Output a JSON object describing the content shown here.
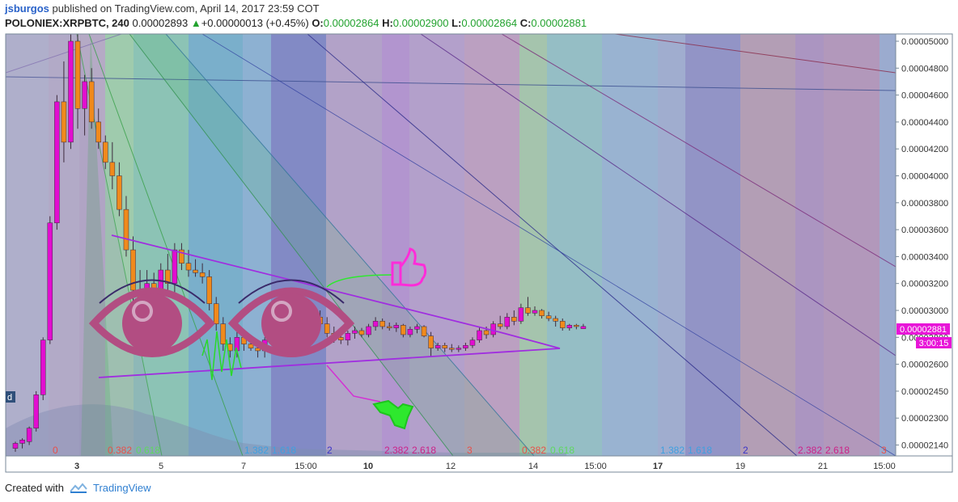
{
  "header": {
    "username": "jsburgos",
    "published_text": "published on TradingView.com, April 14, 2017 23:59 COT",
    "symbol": "POLONIEX:XRPBTC, 240",
    "last_price": "0.00002893",
    "change_arrow": "▲",
    "change": "+0.00000013 (+0.45%)",
    "open_label": "O:",
    "open_value": "0.00002864",
    "high_label": "H:",
    "high_value": "0.00002900",
    "low_label": "L:",
    "low_value": "0.00002864",
    "close_label": "C:",
    "close_value": "0.00002881"
  },
  "price_tag": {
    "price": "0.00002881",
    "countdown": "3:00:15",
    "color": "#e815d8"
  },
  "left_stub": "d",
  "footer": {
    "created_with": "Created with",
    "brand": "TradingView"
  },
  "colors": {
    "bull": "#e20dd0",
    "bear": "#f08a1c",
    "axis_text": "#333333",
    "pattern_line": "#a02de0",
    "eyes": "#b24d82",
    "thumb": "#ff2cd9",
    "arrow": "#2ee82e"
  },
  "chart_data": {
    "type": "candlestick",
    "y_ticks": [
      "0.00005000",
      "0.00004800",
      "0.00004600",
      "0.00004400",
      "0.00004200",
      "0.00004000",
      "0.00003800",
      "0.00003600",
      "0.00003400",
      "0.00003200",
      "0.00003000",
      "0.00002800",
      "0.00002600",
      "0.00002450",
      "0.00002300",
      "0.00002140"
    ],
    "x_ticks": [
      {
        "label": "3",
        "bold": true
      },
      {
        "label": "5",
        "bold": false
      },
      {
        "label": "7",
        "bold": false
      },
      {
        "label": "15:00",
        "bold": false
      },
      {
        "label": "10",
        "bold": true
      },
      {
        "label": "12",
        "bold": false
      },
      {
        "label": "14",
        "bold": false
      },
      {
        "label": "15:00",
        "bold": false
      },
      {
        "label": "17",
        "bold": true
      },
      {
        "label": "19",
        "bold": false
      },
      {
        "label": "21",
        "bold": false
      },
      {
        "label": "15:00",
        "bold": false
      }
    ],
    "fib_labels": [
      {
        "text": "0",
        "color": "#e8504a"
      },
      {
        "text": "0.382",
        "color": "#e8504a"
      },
      {
        "text": "0.618",
        "color": "#5fd85f"
      },
      {
        "text": "1.382",
        "color": "#3fa0e0"
      },
      {
        "text": "1.618",
        "color": "#3fa0e0"
      },
      {
        "text": "2",
        "color": "#3a34c8"
      },
      {
        "text": "2.382",
        "color": "#cc2288"
      },
      {
        "text": "2.618",
        "color": "#cc2288"
      },
      {
        "text": "3",
        "color": "#e8504a"
      },
      {
        "text": "0.382",
        "color": "#e8504a"
      },
      {
        "text": "0.618",
        "color": "#5fd85f"
      },
      {
        "text": "1.382",
        "color": "#3fa0e0"
      },
      {
        "text": "1.618",
        "color": "#3fa0e0"
      },
      {
        "text": "2",
        "color": "#3a34c8"
      },
      {
        "text": "2.382",
        "color": "#cc2288"
      },
      {
        "text": "2.618",
        "color": "#cc2288"
      },
      {
        "text": "3",
        "color": "#e8504a"
      }
    ],
    "candles": [
      [
        2.12e-05,
        2.16e-05,
        2.1e-05,
        2.15e-05
      ],
      [
        2.15e-05,
        2.18e-05,
        2.12e-05,
        2.17e-05
      ],
      [
        2.16e-05,
        2.25e-05,
        2.14e-05,
        2.24e-05
      ],
      [
        2.24e-05,
        2.45e-05,
        2.22e-05,
        2.43e-05
      ],
      [
        2.43e-05,
        2.8e-05,
        2.4e-05,
        2.78e-05
      ],
      [
        2.78e-05,
        3.7e-05,
        2.75e-05,
        3.65e-05
      ],
      [
        3.65e-05,
        4.6e-05,
        3.6e-05,
        4.55e-05
      ],
      [
        4.55e-05,
        4.85e-05,
        4.1e-05,
        4.25e-05
      ],
      [
        4.25e-05,
        5.05e-05,
        4.2e-05,
        5e-05
      ],
      [
        5e-05,
        5.15e-05,
        4.35e-05,
        4.5e-05
      ],
      [
        4.5e-05,
        4.75e-05,
        4.3e-05,
        4.7e-05
      ],
      [
        4.7e-05,
        4.8e-05,
        4.35e-05,
        4.4e-05
      ],
      [
        4.4e-05,
        4.5e-05,
        4.2e-05,
        4.25e-05
      ],
      [
        4.25e-05,
        4.3e-05,
        4.05e-05,
        4.1e-05
      ],
      [
        4.1e-05,
        4.25e-05,
        3.9e-05,
        4e-05
      ],
      [
        4e-05,
        4.1e-05,
        3.7e-05,
        3.75e-05
      ],
      [
        3.75e-05,
        3.85e-05,
        3.4e-05,
        3.45e-05
      ],
      [
        3.45e-05,
        3.55e-05,
        3.05e-05,
        3.15e-05
      ],
      [
        3.15e-05,
        3.3e-05,
        2.9e-05,
        3.05e-05
      ],
      [
        3.05e-05,
        3.3e-05,
        2.95e-05,
        3.2e-05
      ],
      [
        3.2e-05,
        3.28e-05,
        3.1e-05,
        3.15e-05
      ],
      [
        3.15e-05,
        3.35e-05,
        3e-05,
        3.3e-05
      ],
      [
        3.3e-05,
        3.42e-05,
        3.15e-05,
        3.2e-05
      ],
      [
        3.2e-05,
        3.5e-05,
        3.1e-05,
        3.45e-05
      ],
      [
        3.45e-05,
        3.5e-05,
        3.3e-05,
        3.35e-05
      ],
      [
        3.35e-05,
        3.45e-05,
        3.25e-05,
        3.3e-05
      ],
      [
        3.3e-05,
        3.38e-05,
        3.25e-05,
        3.28e-05
      ],
      [
        3.28e-05,
        3.35e-05,
        3.2e-05,
        3.25e-05
      ],
      [
        3.25e-05,
        3.3e-05,
        3e-05,
        3.05e-05
      ],
      [
        3.05e-05,
        3.1e-05,
        2.85e-05,
        2.9e-05
      ],
      [
        2.9e-05,
        2.95e-05,
        2.7e-05,
        2.75e-05
      ],
      [
        2.75e-05,
        2.8e-05,
        2.65e-05,
        2.7e-05
      ],
      [
        2.7e-05,
        2.85e-05,
        2.65e-05,
        2.8e-05
      ],
      [
        2.8e-05,
        2.85e-05,
        2.7e-05,
        2.75e-05
      ],
      [
        2.75e-05,
        2.8e-05,
        2.7e-05,
        2.72e-05
      ],
      [
        2.72e-05,
        2.78e-05,
        2.65e-05,
        2.7e-05
      ],
      [
        2.7e-05,
        2.8e-05,
        2.65e-05,
        2.78e-05
      ],
      [
        2.78e-05,
        2.95e-05,
        2.75e-05,
        2.9e-05
      ],
      [
        2.9e-05,
        3.05e-05,
        2.88e-05,
        3e-05
      ],
      [
        3e-05,
        3.1e-05,
        2.95e-05,
        3.05e-05
      ],
      [
        3.05e-05,
        3.08e-05,
        2.98e-05,
        3.02e-05
      ],
      [
        3.02e-05,
        3.06e-05,
        2.98e-05,
        3.04e-05
      ],
      [
        3.04e-05,
        3.08e-05,
        2.95e-05,
        3e-05
      ],
      [
        3e-05,
        3.05e-05,
        2.92e-05,
        2.95e-05
      ],
      [
        2.95e-05,
        3e-05,
        2.88e-05,
        2.9e-05
      ],
      [
        2.9e-05,
        2.95e-05,
        2.8e-05,
        2.83e-05
      ],
      [
        2.83e-05,
        2.88e-05,
        2.76e-05,
        2.8e-05
      ],
      [
        2.8e-05,
        2.85e-05,
        2.75e-05,
        2.78e-05
      ],
      [
        2.78e-05,
        2.85e-05,
        2.74e-05,
        2.83e-05
      ],
      [
        2.83e-05,
        2.88e-05,
        2.79e-05,
        2.85e-05
      ],
      [
        2.85e-05,
        2.87e-05,
        2.8e-05,
        2.82e-05
      ],
      [
        2.82e-05,
        2.9e-05,
        2.8e-05,
        2.88e-05
      ],
      [
        2.88e-05,
        2.95e-05,
        2.85e-05,
        2.92e-05
      ],
      [
        2.92e-05,
        2.94e-05,
        2.86e-05,
        2.88e-05
      ],
      [
        2.88e-05,
        2.91e-05,
        2.85e-05,
        2.87e-05
      ],
      [
        2.87e-05,
        2.91e-05,
        2.84e-05,
        2.89e-05
      ],
      [
        2.89e-05,
        2.9e-05,
        2.8e-05,
        2.82e-05
      ],
      [
        2.82e-05,
        2.88e-05,
        2.8e-05,
        2.86e-05
      ],
      [
        2.86e-05,
        2.9e-05,
        2.83e-05,
        2.88e-05
      ],
      [
        2.88e-05,
        2.89e-05,
        2.8e-05,
        2.81e-05
      ],
      [
        2.81e-05,
        2.84e-05,
        2.66e-05,
        2.72e-05
      ],
      [
        2.72e-05,
        2.76e-05,
        2.7e-05,
        2.74e-05
      ],
      [
        2.74e-05,
        2.76e-05,
        2.69e-05,
        2.72e-05
      ],
      [
        2.72e-05,
        2.75e-05,
        2.69e-05,
        2.71e-05
      ],
      [
        2.71e-05,
        2.74e-05,
        2.69e-05,
        2.72e-05
      ],
      [
        2.72e-05,
        2.76e-05,
        2.7e-05,
        2.74e-05
      ],
      [
        2.74e-05,
        2.8e-05,
        2.72e-05,
        2.78e-05
      ],
      [
        2.78e-05,
        2.88e-05,
        2.76e-05,
        2.85e-05
      ],
      [
        2.85e-05,
        2.88e-05,
        2.79e-05,
        2.82e-05
      ],
      [
        2.82e-05,
        2.92e-05,
        2.8e-05,
        2.9e-05
      ],
      [
        2.9e-05,
        2.96e-05,
        2.86e-05,
        2.88e-05
      ],
      [
        2.88e-05,
        2.98e-05,
        2.86e-05,
        2.95e-05
      ],
      [
        2.95e-05,
        3e-05,
        2.89e-05,
        2.92e-05
      ],
      [
        2.92e-05,
        3.05e-05,
        2.9e-05,
        3.02e-05
      ],
      [
        3.02e-05,
        3.1e-05,
        2.96e-05,
        2.98e-05
      ],
      [
        2.98e-05,
        3.03e-05,
        2.96e-05,
        3e-05
      ],
      [
        3e-05,
        3.01e-05,
        2.94e-05,
        2.96e-05
      ],
      [
        2.96e-05,
        2.99e-05,
        2.92e-05,
        2.94e-05
      ],
      [
        2.94e-05,
        2.96e-05,
        2.88e-05,
        2.92e-05
      ],
      [
        2.92e-05,
        2.94e-05,
        2.85e-05,
        2.87e-05
      ],
      [
        2.87e-05,
        2.9e-05,
        2.85e-05,
        2.89e-05
      ],
      [
        2.89e-05,
        2.9e-05,
        2.86e-05,
        2.88e-05
      ],
      [
        2.864e-05,
        2.9e-05,
        2.864e-05,
        2.881e-05
      ]
    ]
  }
}
